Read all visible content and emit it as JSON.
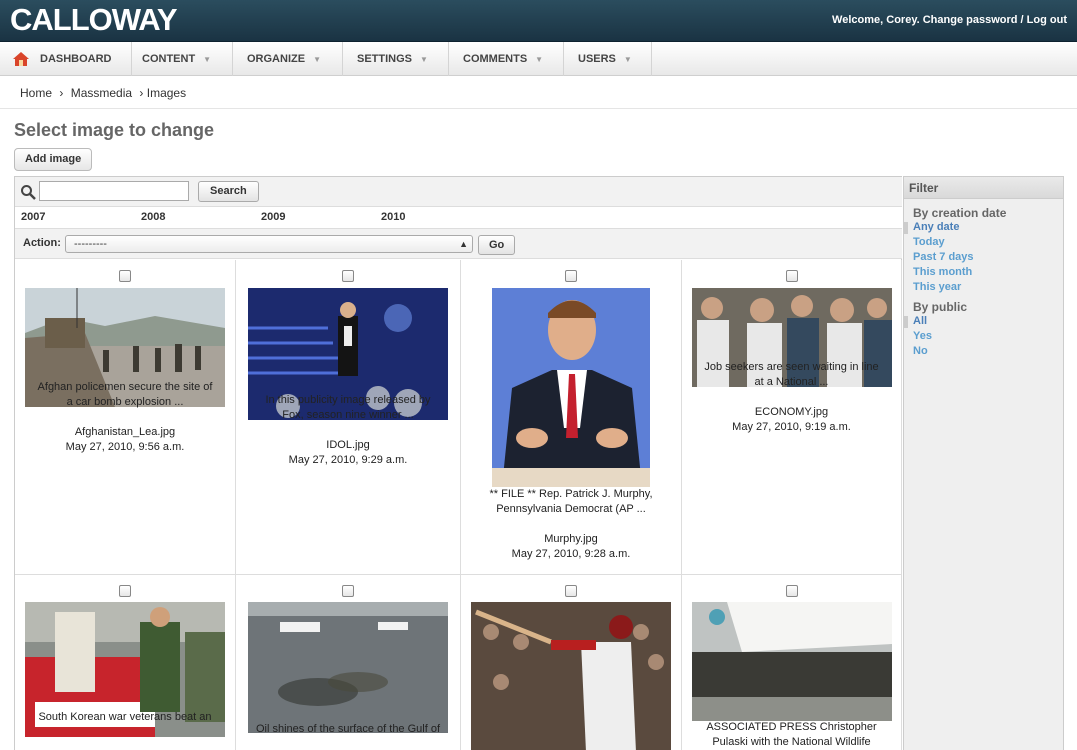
{
  "header": {
    "logo": "CALLOWAY",
    "welcome": "Welcome, Corey.",
    "change_password": "Change password",
    "separator": "/",
    "logout": "Log out"
  },
  "nav": {
    "items": [
      {
        "label": "DASHBOARD",
        "icon": "home-icon"
      },
      {
        "label": "CONTENT",
        "dropdown": true
      },
      {
        "label": "ORGANIZE",
        "dropdown": true
      },
      {
        "label": "SETTINGS",
        "dropdown": true
      },
      {
        "label": "COMMENTS",
        "dropdown": true
      },
      {
        "label": "USERS",
        "dropdown": true
      }
    ]
  },
  "breadcrumb": {
    "home": "Home",
    "sep": "›",
    "section": "Massmedia",
    "current": "› Images"
  },
  "page": {
    "title": "Select image to change",
    "add_button": "Add image"
  },
  "search": {
    "button": "Search",
    "value": ""
  },
  "dates": [
    "2007",
    "2008",
    "2009",
    "2010"
  ],
  "actions": {
    "label": "Action:",
    "selected": "---------",
    "go": "Go"
  },
  "images": [
    {
      "caption1": "Afghan policemen secure the site of",
      "caption2": "a car bomb explosion ...",
      "filename": "Afghanistan_Lea.jpg",
      "date": "May 27, 2010, 9:56 a.m."
    },
    {
      "caption1": "In this publicity image released by",
      "caption2": "Fox, season nine winner ...",
      "filename": "IDOL.jpg",
      "date": "May 27, 2010, 9:29 a.m."
    },
    {
      "caption1": "** FILE ** Rep. Patrick J. Murphy,",
      "caption2": "Pennsylvania Democrat (AP ...",
      "filename": "Murphy.jpg",
      "date": "May 27, 2010, 9:28 a.m."
    },
    {
      "caption1": "Job seekers are seen waiting in line",
      "caption2": "at a National ...",
      "filename": "ECONOMY.jpg",
      "date": "May 27, 2010, 9:19 a.m."
    },
    {
      "caption1": "South Korean war veterans beat an",
      "caption2": "",
      "filename": "",
      "date": ""
    },
    {
      "caption1": "Oil shines of the surface of the Gulf of",
      "caption2": "",
      "filename": "",
      "date": ""
    },
    {
      "caption1": "",
      "caption2": "",
      "filename": "",
      "date": ""
    },
    {
      "caption1": "ASSOCIATED PRESS Christopher",
      "caption2": "Pulaski with the National Wildlife",
      "filename": "",
      "date": ""
    }
  ],
  "filter": {
    "title": "Filter",
    "groups": [
      {
        "heading": "By creation date",
        "options": [
          "Any date",
          "Today",
          "Past 7 days",
          "This month",
          "This year"
        ],
        "selected": "Any date"
      },
      {
        "heading": "By public",
        "options": [
          "All",
          "Yes",
          "No"
        ],
        "selected": "All"
      }
    ]
  },
  "colors": {
    "header_bg": "#1f3b4b",
    "filter_link": "#5b9ecf"
  }
}
